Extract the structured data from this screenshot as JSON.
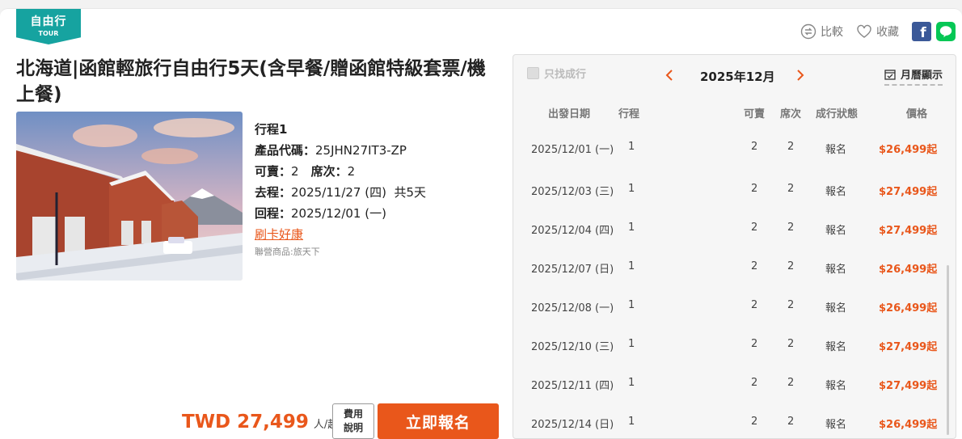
{
  "badge": {
    "main": "自由行",
    "sub": "TOUR"
  },
  "actions": {
    "compare": "比較",
    "favorite": "收藏",
    "facebook": "f"
  },
  "product": {
    "title": "北海道|函館輕旅行自由行5天(含早餐/贈函館特級套票/機上餐)",
    "itinerary": "行程1",
    "code_label": "產品代碼：",
    "code": "25JHN27IT3-ZP",
    "avail_label": "可賣：",
    "avail": "2",
    "seat_label": "席次：",
    "seat": "2",
    "depart_label": "去程：",
    "depart": "2025/11/27 (四)",
    "duration": "共5天",
    "return_label": "回程：",
    "return": "2025/12/01 (一)",
    "promo_link": "刷卡好康",
    "partner": "聯營商品:旅天下"
  },
  "purchase": {
    "price": "TWD 27,499",
    "per": "人/起",
    "fee_line1": "費用",
    "fee_line2": "說明",
    "signup": "立即報名"
  },
  "calendar": {
    "filter_label": "只找成行",
    "month": "2025年12月",
    "view_label": "月曆顯示",
    "headers": {
      "date": "出發日期",
      "trip": "行程",
      "avail": "可賣",
      "seat": "席次",
      "status": "成行狀態",
      "price": "價格"
    },
    "rows": [
      {
        "date": "2025/12/01 (一)",
        "trip": "1",
        "avail": "2",
        "seat": "2",
        "status": "報名",
        "price": "$26,499起"
      },
      {
        "date": "2025/12/03 (三)",
        "trip": "1",
        "avail": "2",
        "seat": "2",
        "status": "報名",
        "price": "$27,499起"
      },
      {
        "date": "2025/12/04 (四)",
        "trip": "1",
        "avail": "2",
        "seat": "2",
        "status": "報名",
        "price": "$27,499起"
      },
      {
        "date": "2025/12/07 (日)",
        "trip": "1",
        "avail": "2",
        "seat": "2",
        "status": "報名",
        "price": "$26,499起"
      },
      {
        "date": "2025/12/08 (一)",
        "trip": "1",
        "avail": "2",
        "seat": "2",
        "status": "報名",
        "price": "$26,499起"
      },
      {
        "date": "2025/12/10 (三)",
        "trip": "1",
        "avail": "2",
        "seat": "2",
        "status": "報名",
        "price": "$27,499起"
      },
      {
        "date": "2025/12/11 (四)",
        "trip": "1",
        "avail": "2",
        "seat": "2",
        "status": "報名",
        "price": "$27,499起"
      },
      {
        "date": "2025/12/14 (日)",
        "trip": "1",
        "avail": "2",
        "seat": "2",
        "status": "報名",
        "price": "$26,499起"
      }
    ]
  },
  "colors": {
    "accent": "#e9571b",
    "badge": "#16a3a0",
    "facebook": "#3b5998",
    "line": "#06c755"
  }
}
